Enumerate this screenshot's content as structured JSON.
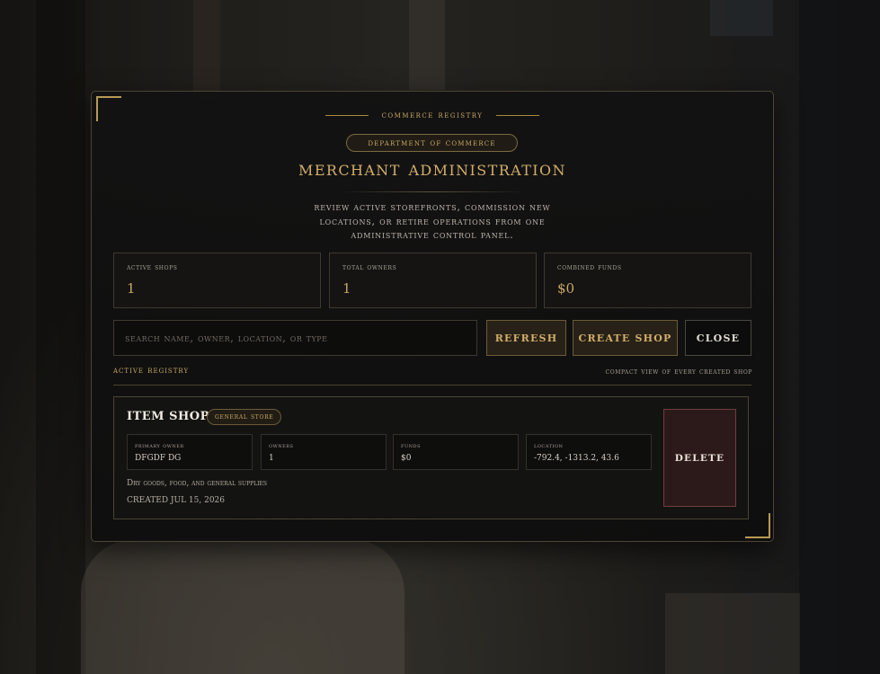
{
  "header": {
    "kicker": "Commerce Registry",
    "department_badge": "Department of Commerce",
    "title": "Merchant Administration",
    "subtitle": "Review active storefronts, commission new locations, or retire operations from one administrative control panel."
  },
  "stats": [
    {
      "label": "Active Shops",
      "value": "1"
    },
    {
      "label": "Total Owners",
      "value": "1"
    },
    {
      "label": "Combined Funds",
      "value": "$0"
    }
  ],
  "toolbar": {
    "search_placeholder": "Search name, owner, location, or type",
    "search_value": "",
    "refresh_label": "Refresh",
    "create_label": "Create Shop",
    "close_label": "Close"
  },
  "registry": {
    "label": "Active Registry",
    "note": "Compact view of every created shop",
    "shops": [
      {
        "name": "Item Shop",
        "type": "General Store",
        "fields": [
          {
            "label": "Primary Owner",
            "value": "DFGDF DG"
          },
          {
            "label": "Owners",
            "value": "1"
          },
          {
            "label": "Funds",
            "value": "$0"
          },
          {
            "label": "Location",
            "value": "-792.4, -1313.2, 43.6"
          }
        ],
        "description": "Dry goods, food, and general supplies",
        "created": "Created Jul 15, 2026",
        "delete_label": "Delete"
      }
    ]
  },
  "colors": {
    "accent_gold": "#c9a866",
    "panel_bg": "#121212",
    "delete_bg": "#301c1c"
  }
}
